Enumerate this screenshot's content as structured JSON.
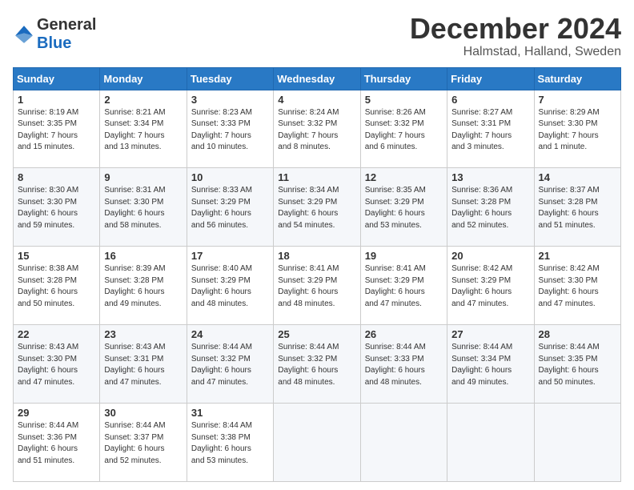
{
  "header": {
    "logo_general": "General",
    "logo_blue": "Blue",
    "month_title": "December 2024",
    "location": "Halmstad, Halland, Sweden"
  },
  "weekdays": [
    "Sunday",
    "Monday",
    "Tuesday",
    "Wednesday",
    "Thursday",
    "Friday",
    "Saturday"
  ],
  "weeks": [
    [
      {
        "day": "1",
        "info": "Sunrise: 8:19 AM\nSunset: 3:35 PM\nDaylight: 7 hours\nand 15 minutes."
      },
      {
        "day": "2",
        "info": "Sunrise: 8:21 AM\nSunset: 3:34 PM\nDaylight: 7 hours\nand 13 minutes."
      },
      {
        "day": "3",
        "info": "Sunrise: 8:23 AM\nSunset: 3:33 PM\nDaylight: 7 hours\nand 10 minutes."
      },
      {
        "day": "4",
        "info": "Sunrise: 8:24 AM\nSunset: 3:32 PM\nDaylight: 7 hours\nand 8 minutes."
      },
      {
        "day": "5",
        "info": "Sunrise: 8:26 AM\nSunset: 3:32 PM\nDaylight: 7 hours\nand 6 minutes."
      },
      {
        "day": "6",
        "info": "Sunrise: 8:27 AM\nSunset: 3:31 PM\nDaylight: 7 hours\nand 3 minutes."
      },
      {
        "day": "7",
        "info": "Sunrise: 8:29 AM\nSunset: 3:30 PM\nDaylight: 7 hours\nand 1 minute."
      }
    ],
    [
      {
        "day": "8",
        "info": "Sunrise: 8:30 AM\nSunset: 3:30 PM\nDaylight: 6 hours\nand 59 minutes."
      },
      {
        "day": "9",
        "info": "Sunrise: 8:31 AM\nSunset: 3:30 PM\nDaylight: 6 hours\nand 58 minutes."
      },
      {
        "day": "10",
        "info": "Sunrise: 8:33 AM\nSunset: 3:29 PM\nDaylight: 6 hours\nand 56 minutes."
      },
      {
        "day": "11",
        "info": "Sunrise: 8:34 AM\nSunset: 3:29 PM\nDaylight: 6 hours\nand 54 minutes."
      },
      {
        "day": "12",
        "info": "Sunrise: 8:35 AM\nSunset: 3:29 PM\nDaylight: 6 hours\nand 53 minutes."
      },
      {
        "day": "13",
        "info": "Sunrise: 8:36 AM\nSunset: 3:28 PM\nDaylight: 6 hours\nand 52 minutes."
      },
      {
        "day": "14",
        "info": "Sunrise: 8:37 AM\nSunset: 3:28 PM\nDaylight: 6 hours\nand 51 minutes."
      }
    ],
    [
      {
        "day": "15",
        "info": "Sunrise: 8:38 AM\nSunset: 3:28 PM\nDaylight: 6 hours\nand 50 minutes."
      },
      {
        "day": "16",
        "info": "Sunrise: 8:39 AM\nSunset: 3:28 PM\nDaylight: 6 hours\nand 49 minutes."
      },
      {
        "day": "17",
        "info": "Sunrise: 8:40 AM\nSunset: 3:29 PM\nDaylight: 6 hours\nand 48 minutes."
      },
      {
        "day": "18",
        "info": "Sunrise: 8:41 AM\nSunset: 3:29 PM\nDaylight: 6 hours\nand 48 minutes."
      },
      {
        "day": "19",
        "info": "Sunrise: 8:41 AM\nSunset: 3:29 PM\nDaylight: 6 hours\nand 47 minutes."
      },
      {
        "day": "20",
        "info": "Sunrise: 8:42 AM\nSunset: 3:29 PM\nDaylight: 6 hours\nand 47 minutes."
      },
      {
        "day": "21",
        "info": "Sunrise: 8:42 AM\nSunset: 3:30 PM\nDaylight: 6 hours\nand 47 minutes."
      }
    ],
    [
      {
        "day": "22",
        "info": "Sunrise: 8:43 AM\nSunset: 3:30 PM\nDaylight: 6 hours\nand 47 minutes."
      },
      {
        "day": "23",
        "info": "Sunrise: 8:43 AM\nSunset: 3:31 PM\nDaylight: 6 hours\nand 47 minutes."
      },
      {
        "day": "24",
        "info": "Sunrise: 8:44 AM\nSunset: 3:32 PM\nDaylight: 6 hours\nand 47 minutes."
      },
      {
        "day": "25",
        "info": "Sunrise: 8:44 AM\nSunset: 3:32 PM\nDaylight: 6 hours\nand 48 minutes."
      },
      {
        "day": "26",
        "info": "Sunrise: 8:44 AM\nSunset: 3:33 PM\nDaylight: 6 hours\nand 48 minutes."
      },
      {
        "day": "27",
        "info": "Sunrise: 8:44 AM\nSunset: 3:34 PM\nDaylight: 6 hours\nand 49 minutes."
      },
      {
        "day": "28",
        "info": "Sunrise: 8:44 AM\nSunset: 3:35 PM\nDaylight: 6 hours\nand 50 minutes."
      }
    ],
    [
      {
        "day": "29",
        "info": "Sunrise: 8:44 AM\nSunset: 3:36 PM\nDaylight: 6 hours\nand 51 minutes."
      },
      {
        "day": "30",
        "info": "Sunrise: 8:44 AM\nSunset: 3:37 PM\nDaylight: 6 hours\nand 52 minutes."
      },
      {
        "day": "31",
        "info": "Sunrise: 8:44 AM\nSunset: 3:38 PM\nDaylight: 6 hours\nand 53 minutes."
      },
      {
        "day": "",
        "info": ""
      },
      {
        "day": "",
        "info": ""
      },
      {
        "day": "",
        "info": ""
      },
      {
        "day": "",
        "info": ""
      }
    ]
  ]
}
